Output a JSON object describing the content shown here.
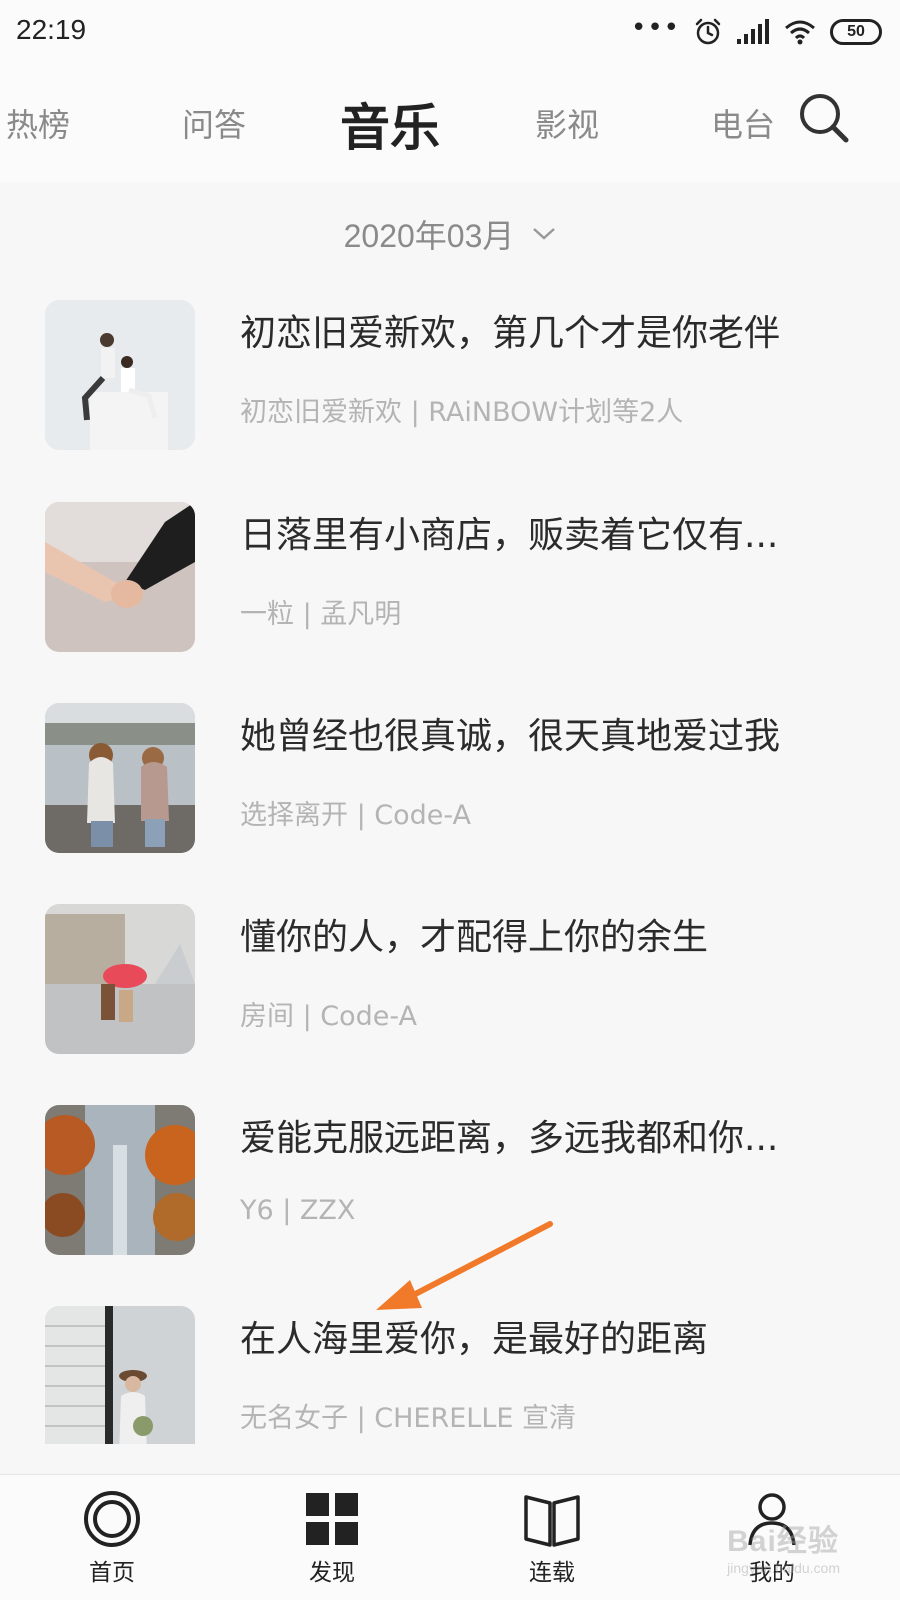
{
  "status": {
    "time": "22:19",
    "battery": "50",
    "icons": [
      "more-dots-icon",
      "alarm-icon",
      "signal-icon",
      "wifi-icon",
      "battery-icon"
    ]
  },
  "nav": {
    "tabs": [
      {
        "label": "热榜",
        "active": false
      },
      {
        "label": "问答",
        "active": false
      },
      {
        "label": "音乐",
        "active": true
      },
      {
        "label": "影视",
        "active": false
      },
      {
        "label": "电台",
        "active": false
      }
    ],
    "search_icon": "search-icon"
  },
  "filter": {
    "date": "2020年03月",
    "icon": "chevron-down-icon"
  },
  "list": [
    {
      "title": "初恋旧爱新欢，第几个才是你老伴",
      "subtitle": "初恋旧爱新欢 | RAiNBOW计划等2人"
    },
    {
      "title": "日落里有小商店，贩卖着它仅有...",
      "subtitle": "一粒 | 孟凡明"
    },
    {
      "title": "她曾经也很真诚，很天真地爱过我",
      "subtitle": "选择离开 | Code-A"
    },
    {
      "title": "懂你的人，才配得上你的余生",
      "subtitle": "房间 | Code-A"
    },
    {
      "title": "爱能克服远距离，多远我都和你...",
      "subtitle": "Y6 | ZZX"
    },
    {
      "title": "在人海里爱你，是最好的距离",
      "subtitle": "无名女子 | CHERELLE 宣清"
    }
  ],
  "bottom_nav": [
    {
      "label": "首页",
      "icon": "home-circle-icon"
    },
    {
      "label": "发现",
      "icon": "grid-icon"
    },
    {
      "label": "连载",
      "icon": "book-icon"
    },
    {
      "label": "我的",
      "icon": "user-icon"
    }
  ],
  "watermark": {
    "text": "Bai经验",
    "url": "jingyan.baidu.com"
  },
  "colors": {
    "annotation_arrow": "#f07a2a",
    "background": "#f7f7f7",
    "text_primary": "#2b2b2b",
    "text_secondary": "#b4b4b4"
  }
}
